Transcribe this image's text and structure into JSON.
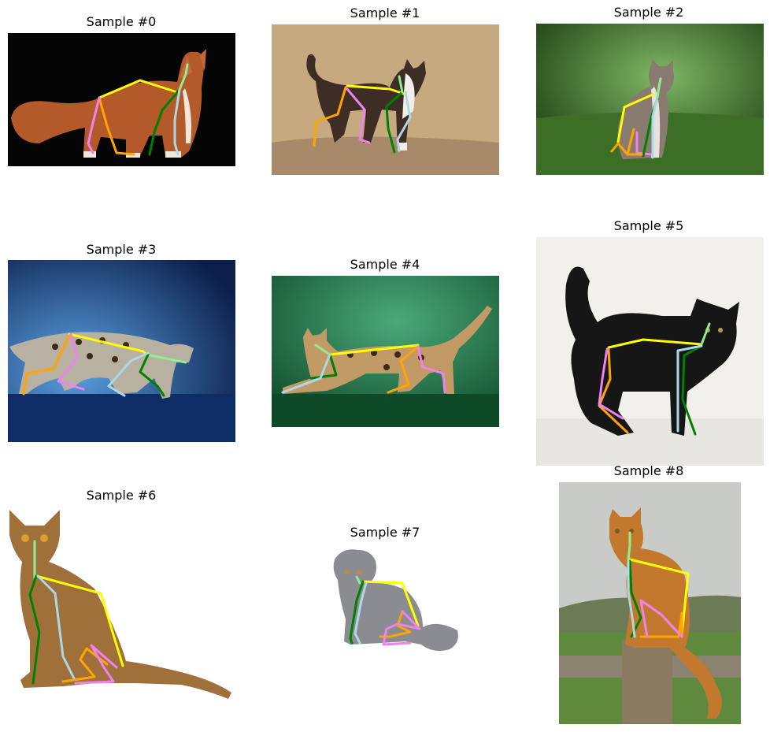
{
  "figure": {
    "panels": [
      {
        "title": "Sample #0",
        "scene": "orange long-haired cat standing on black background"
      },
      {
        "title": "Sample #1",
        "scene": "black and white cat walking on dirt ground"
      },
      {
        "title": "Sample #2",
        "scene": "tabby cat sitting in green grass"
      },
      {
        "title": "Sample #3",
        "scene": "spotted bengal cat walking on blue background"
      },
      {
        "title": "Sample #4",
        "scene": "spotted bengal cat crouching on green background"
      },
      {
        "title": "Sample #5",
        "scene": "fluffy black kitten standing on white background"
      },
      {
        "title": "Sample #6",
        "scene": "abyssinian cat sitting on white background"
      },
      {
        "title": "Sample #7",
        "scene": "grey scottish fold cat sitting on white background"
      },
      {
        "title": "Sample #8",
        "scene": "orange tabby cat sitting on wooden fence post"
      }
    ]
  },
  "skeleton_colors": {
    "spine": "#ffff00",
    "head_neck": "#90ee90",
    "front_left_leg": "#008000",
    "front_right_leg": "#add8e6",
    "back_left_leg": "#ffa500",
    "back_right_leg": "#ee82ee"
  }
}
